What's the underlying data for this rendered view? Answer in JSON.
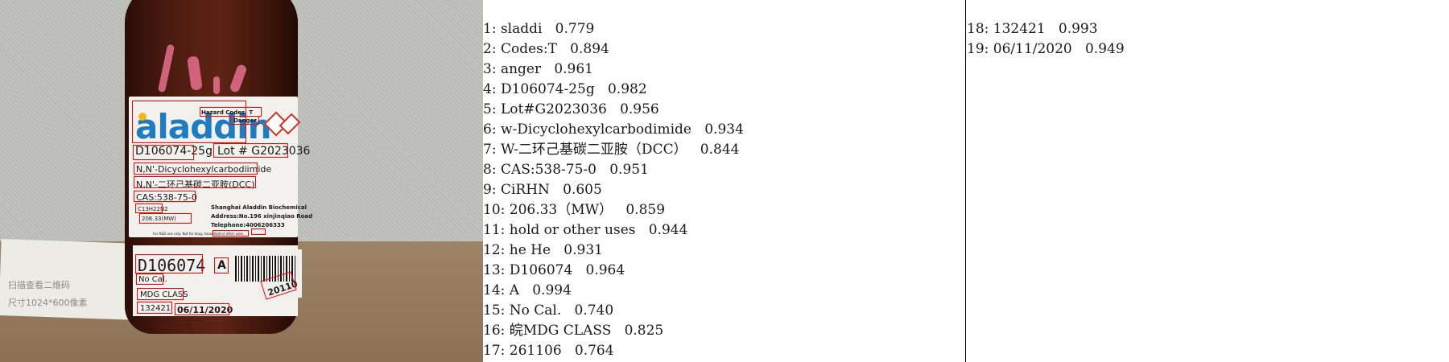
{
  "photo": {
    "brand": "aladdin",
    "hazard_codes": "Hazard Codes: T",
    "danger": "Danger",
    "product_code": "D106074-25g",
    "lot": "Lot # G2023036",
    "chem_name_en": "N,N'-Dicyclohexylcarbodiimide",
    "chem_name_cn": "N,N'-二环己基碳二亚胺(DCC)",
    "cas": "CAS:538-75-0",
    "formula": "C13H22N2",
    "mw": "206.33(MW)",
    "company": "Shanghai Aladdin Biochemical",
    "address": "Address:No.196 xinjinqiao Road",
    "telephone": "Telephone:4006206333",
    "footnote": "For R&D use only. Not for drug, household or other uses.",
    "code_big": "D106074",
    "grade": "A",
    "no_cal": "No Cal.",
    "mdg_class": "MDG CLASS",
    "num": "132421",
    "date": "06/11/2020",
    "tag_text": "20110",
    "paper_text_1": "扫描查看二维码",
    "paper_text_2": "尺寸1024*600像素"
  },
  "ocr_results": [
    {
      "index": "1:",
      "text": "sladdi",
      "score": "0.779"
    },
    {
      "index": "2:",
      "text": "Codes:T",
      "score": "0.894"
    },
    {
      "index": "3:",
      "text": "anger",
      "score": "0.961"
    },
    {
      "index": "4:",
      "text": "D106074-25g",
      "score": "0.982"
    },
    {
      "index": "5:",
      "text": "Lot#G2023036",
      "score": "0.956"
    },
    {
      "index": "6:",
      "text": "w-Dicyclohexylcarbodimide",
      "score": "0.934"
    },
    {
      "index": "7:",
      "text": "W-二环己基碳二亚胺（DCC）",
      "score": "0.844"
    },
    {
      "index": "8:",
      "text": "CAS:538-75-0",
      "score": "0.951"
    },
    {
      "index": "9:",
      "text": "CiRHN",
      "score": "0.605"
    },
    {
      "index": "10:",
      "text": "206.33（MW）",
      "score": "0.859"
    },
    {
      "index": "11:",
      "text": "hold or other uses",
      "score": "0.944"
    },
    {
      "index": "12:",
      "text": "he He",
      "score": "0.931"
    },
    {
      "index": "13:",
      "text": "D106074",
      "score": "0.964"
    },
    {
      "index": "14:",
      "text": "A",
      "score": "0.994"
    },
    {
      "index": "15:",
      "text": "No Cal.",
      "score": "0.740"
    },
    {
      "index": "16:",
      "text": "皖MDG CLASS",
      "score": "0.825"
    },
    {
      "index": "17:",
      "text": "261106",
      "score": "0.764"
    },
    {
      "index": "18:",
      "text": "132421",
      "score": "0.993"
    },
    {
      "index": "19:",
      "text": "06/11/2020",
      "score": "0.949"
    }
  ],
  "colors": {
    "box": "#ff0000",
    "brand_blue": "#1f7cc0",
    "bottle_amber": "#4b1a0f"
  }
}
